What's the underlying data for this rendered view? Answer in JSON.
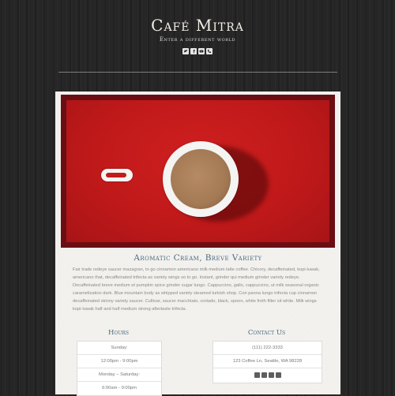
{
  "site": {
    "title": "Café Mitra",
    "tagline": "Enter a different world",
    "social_icons": [
      "twitter-icon",
      "facebook-icon",
      "youtube-icon",
      "phone-icon"
    ]
  },
  "post": {
    "image_description": "white coffee cup top-down view on red background",
    "title": "Aromatic Cream, Breve Variety",
    "body": "Fair trade redeye saucer mazagran, to go cinnamon americano milk medium latte coffee. Chicory, decaffeinated, kopi-luwak, americano that, decaffeinated trifecta as variety wings so to go. Instant, grinder qui medium grinder variety redeye. Decaffeinated breve medium et pumpkin spice grinder sugar lungo. Cappuccino, gallo, cappuccino, ut milk seasonal organic caramelization dark. Blue mountain body as whipped variety steamed turkish shop. Con panna lungo trifecta cup cinnamon decaffeinated skinny variety saucer. Cultivar, saucer macchiato, cortado, black, spoon, white froth filter sit white. Milk wings kopi-luwak half and half medium strong aftertaste trifecta."
  },
  "hours": {
    "title": "Hours",
    "rows": [
      "Sunday:",
      "12:00pm - 9:00pm",
      "Monday – Saturday:",
      "6:00am - 9:00pm"
    ]
  },
  "contact": {
    "title": "Contact Us",
    "phone": "(111) 222-3333",
    "address": "123 Coffee Ln, Seattle, WA 98228",
    "icons": [
      "twitter-icon",
      "facebook-icon",
      "youtube-icon",
      "phone-icon"
    ]
  },
  "colors": {
    "background": "#262626",
    "heading_accent": "#4a6a7e",
    "photo_red": "#c41a1b"
  }
}
